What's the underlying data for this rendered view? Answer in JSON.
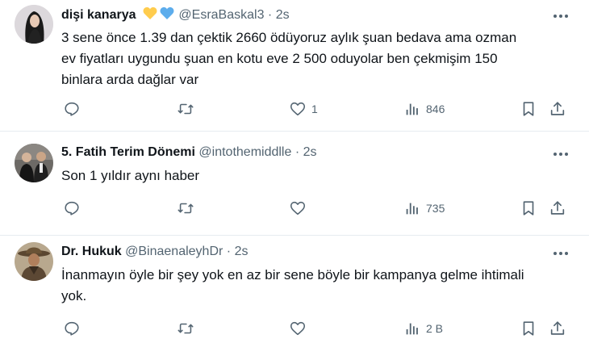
{
  "tweets": [
    {
      "name": "dişi kanarya",
      "emoji": "💛💙",
      "handle": "@EsraBaskal3",
      "dot": "·",
      "time": "2s",
      "text_lines": [
        "3 sene önce 1.39 dan çektik 2660 ödüyoruz aylık şuan bedava ama ozman",
        "ev fiyatları uygundu şuan en kotu eve 2 500 oduyolar ben çekmişim 150",
        "binlara arda dağlar var"
      ],
      "replies": "",
      "retweets": "",
      "likes": "1",
      "views": "846"
    },
    {
      "name": "5. Fatih Terim Dönemi",
      "emoji": "",
      "handle": "@intothemiddlle",
      "dot": "·",
      "time": "2s",
      "text_lines": [
        "Son 1 yıldır aynı haber"
      ],
      "replies": "",
      "retweets": "",
      "likes": "",
      "views": "735"
    },
    {
      "name": "Dr. Hukuk",
      "emoji": "",
      "handle": "@BinaenaleyhDr",
      "dot": "·",
      "time": "2s",
      "text_lines": [
        "İnanmayın öyle bir şey yok en az bir sene böyle bir kampanya gelme ihtimali",
        "yok."
      ],
      "replies": "",
      "retweets": "",
      "likes": "",
      "views": "2 B"
    }
  ],
  "icons": {
    "reply": "reply-icon",
    "retweet": "retweet-icon",
    "like": "heart-icon",
    "views": "views-icon",
    "bookmark": "bookmark-icon",
    "share": "share-icon",
    "more": "more-icon"
  },
  "colors": {
    "text": "#0f1419",
    "muted": "#536471",
    "divider": "#e6ecf0",
    "heart_yellow": "#ffcc4d",
    "heart_blue": "#5dadec"
  }
}
